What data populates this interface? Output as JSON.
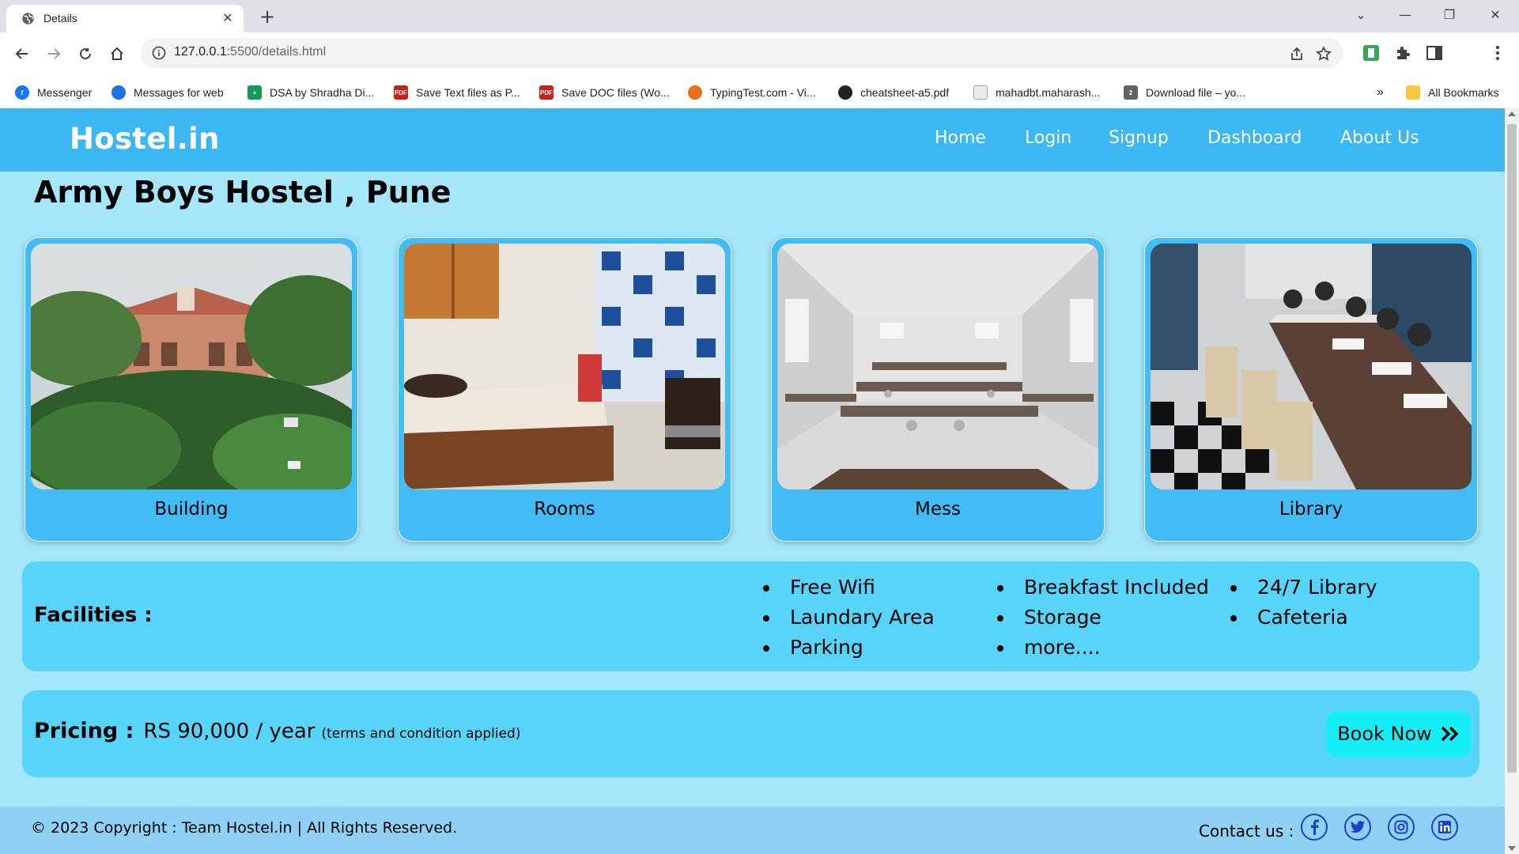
{
  "browser": {
    "tab_title": "Details",
    "close_glyph": "✕",
    "new_tab_glyph": "+",
    "url_host": "127.0.0.1",
    "url_path": ":5500/details.html",
    "window_controls": {
      "dropdown": "⌄",
      "minimize": "—",
      "restore": "❐",
      "close": "✕"
    },
    "bookmarks": [
      {
        "label": "Messenger",
        "icon": "messenger-icon",
        "color": "#1877f2"
      },
      {
        "label": "Messages for web",
        "icon": "messages-icon",
        "color": "#1a73e8"
      },
      {
        "label": "DSA by Shradha Di...",
        "icon": "sheets-icon",
        "color": "#0f9d58"
      },
      {
        "label": "Save Text files as P...",
        "icon": "pdf-icon",
        "color": "#c5221f"
      },
      {
        "label": "Save DOC files (Wo...",
        "icon": "pdf-icon",
        "color": "#c5221f"
      },
      {
        "label": "TypingTest.com - Vi...",
        "icon": "typingtest-icon",
        "color": "#e8711a"
      },
      {
        "label": "cheatsheet-a5.pdf",
        "icon": "cheatsheet-icon",
        "color": "#202124"
      },
      {
        "label": "mahadbt.maharash...",
        "icon": "document-icon",
        "color": "#9aa0a6"
      },
      {
        "label": "Download file – yo...",
        "icon": "download-file-icon",
        "color": "#5f6368"
      }
    ],
    "bookmarks_overflow": "»",
    "all_bookmarks": "All Bookmarks"
  },
  "site": {
    "logo": "Hostel.in",
    "nav": [
      "Home",
      "Login",
      "Signup",
      "Dashboard",
      "About Us"
    ],
    "hostel_name": "Army Boys Hostel , Pune",
    "cards": [
      {
        "caption": "Building",
        "image": "building-photo"
      },
      {
        "caption": "Rooms",
        "image": "rooms-photo"
      },
      {
        "caption": "Mess",
        "image": "mess-photo"
      },
      {
        "caption": "Library",
        "image": "library-photo"
      }
    ],
    "facilities": {
      "label": "Facilities :",
      "columns": [
        [
          "Free Wifi",
          "Laundary Area",
          "Parking"
        ],
        [
          "Breakfast Included",
          "Storage",
          "more...."
        ],
        [
          "24/7 Library",
          "Cafeteria"
        ]
      ]
    },
    "pricing": {
      "label": "Pricing :",
      "value": "RS 90,000 / year",
      "note": "(terms and condition applied)",
      "book_label": "Book Now"
    },
    "footer": {
      "copyright": "© 2023 Copyright : Team Hostel.in | All Rights Reserved.",
      "contact_label": "Contact us :",
      "social": [
        "facebook-icon",
        "twitter-icon",
        "instagram-icon",
        "linkedin-icon"
      ],
      "accent": "#1e3fc8"
    }
  }
}
